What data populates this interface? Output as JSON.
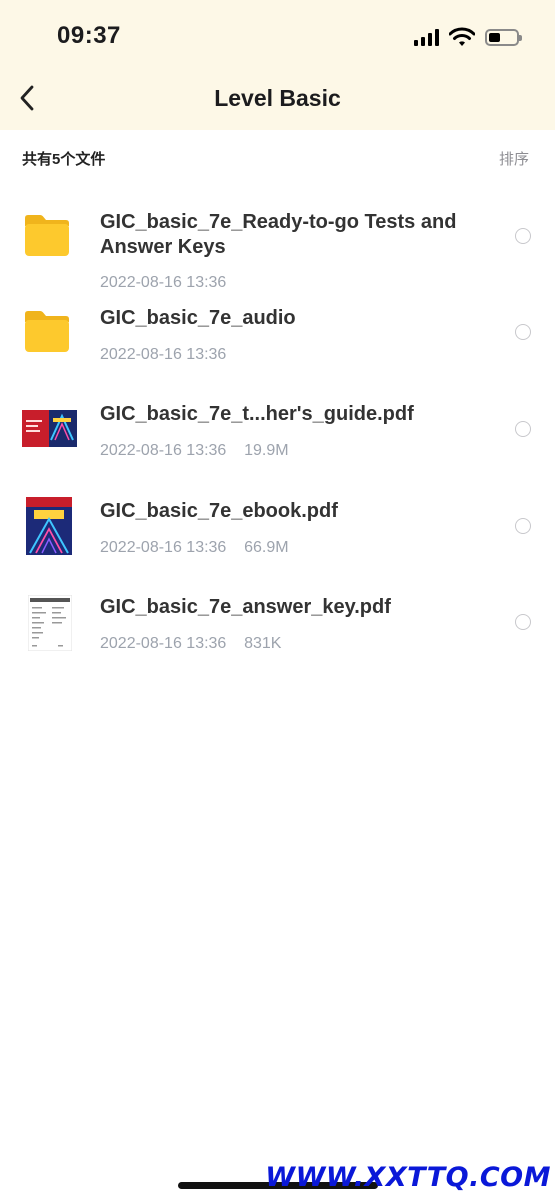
{
  "status_bar": {
    "time": "09:37"
  },
  "nav": {
    "title": "Level Basic"
  },
  "list_header": {
    "count_label": "共有5个文件",
    "sort_label": "排序"
  },
  "files": [
    {
      "name": "GIC_basic_7e_Ready-to-go Tests and Answer Keys",
      "meta": "2022-08-16 13:36",
      "icon": "folder-icon"
    },
    {
      "name": "GIC_basic_7e_audio",
      "meta": "2022-08-16 13:36",
      "icon": "folder-icon"
    },
    {
      "name": "GIC_basic_7e_t...her's_guide.pdf",
      "meta": "2022-08-16 13:36    19.9M",
      "icon": "pdf-thumbnail"
    },
    {
      "name": "GIC_basic_7e_ebook.pdf",
      "meta": "2022-08-16 13:36    66.9M",
      "icon": "pdf-thumbnail"
    },
    {
      "name": "GIC_basic_7e_answer_key.pdf",
      "meta": "2022-08-16 13:36    831K",
      "icon": "pdf-thumbnail"
    }
  ],
  "watermark": "WWW.XXTTQ.COM",
  "colors": {
    "header_bg": "#fdf8e7",
    "folder": "#fdc92d",
    "meta_text": "#9da3ad",
    "watermark": "#0a18d8"
  }
}
